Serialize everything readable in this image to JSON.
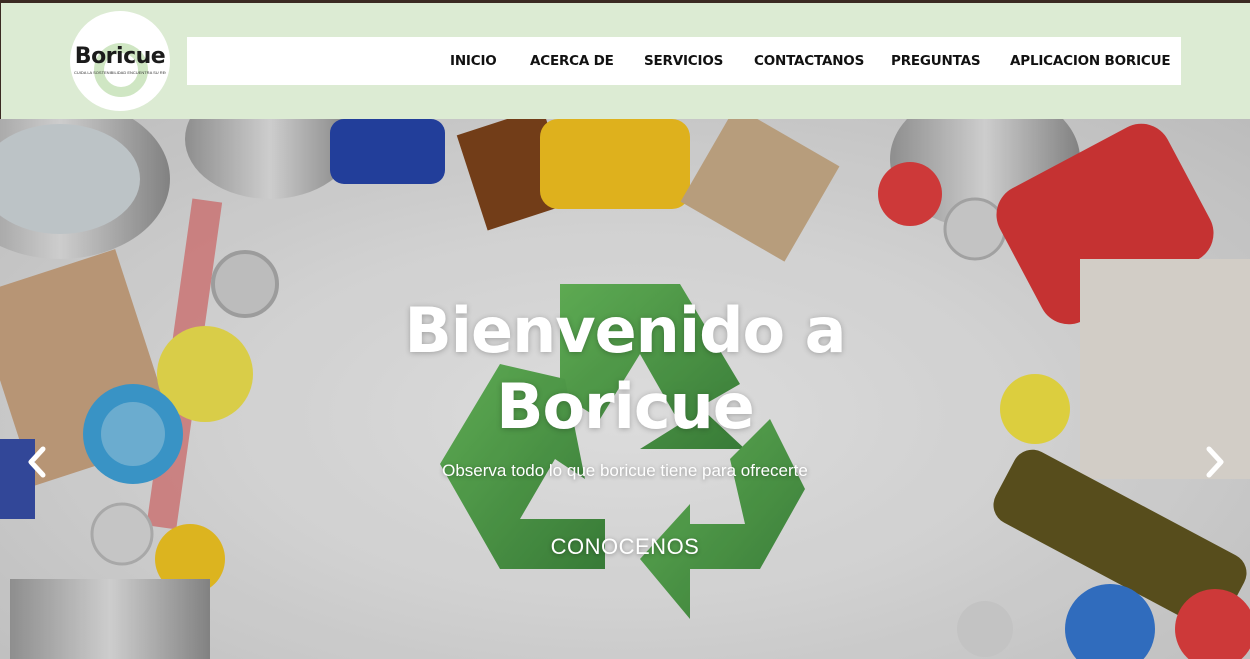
{
  "brand": {
    "name": "Boricue",
    "tagline": "CUIDA LA SOSTENIBILIDAD ENCUENTRA SU RECICLADO"
  },
  "nav": {
    "items": [
      {
        "label": "INICIO"
      },
      {
        "label": "ACERCA DE"
      },
      {
        "label": "SERVICIOS"
      },
      {
        "label": "CONTACTANOS"
      },
      {
        "label": "PREGUNTAS"
      },
      {
        "label": "APLICACION BORICUE"
      }
    ]
  },
  "hero": {
    "title_line1": "Bienvenido a",
    "title_line2": "Boricue",
    "subtitle": "Observa todo lo que boricue tiene para ofrecerte",
    "cta": "CONOCENOS"
  },
  "carousel": {
    "prev_icon": "chevron-left-icon",
    "next_icon": "chevron-right-icon"
  },
  "colors": {
    "header_bg": "#dcebd3",
    "nav_bg": "#ffffff",
    "recycle_green": "#3f9a3a",
    "text_light": "#ffffff"
  }
}
